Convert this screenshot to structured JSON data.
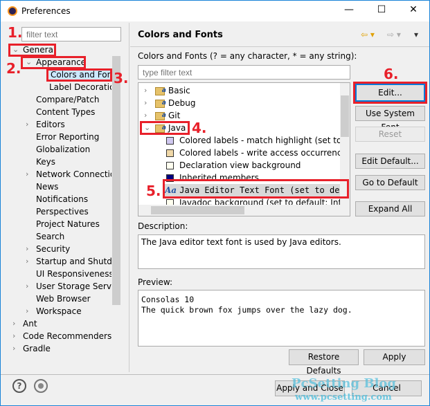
{
  "window": {
    "title": "Preferences",
    "minimize": "—",
    "maximize": "☐",
    "close": "✕"
  },
  "left": {
    "filter_placeholder": "filter text",
    "tree": [
      {
        "label": "General",
        "level": 0,
        "expanded": true
      },
      {
        "label": "Appearance",
        "level": 1,
        "expanded": true
      },
      {
        "label": "Colors and Font",
        "level": 2,
        "selected": true
      },
      {
        "label": "Label Decoratio",
        "level": 2
      },
      {
        "label": "Compare/Patch",
        "level": 1
      },
      {
        "label": "Content Types",
        "level": 1
      },
      {
        "label": "Editors",
        "level": 1,
        "collapsed": true
      },
      {
        "label": "Error Reporting",
        "level": 1
      },
      {
        "label": "Globalization",
        "level": 1
      },
      {
        "label": "Keys",
        "level": 1
      },
      {
        "label": "Network Connectio",
        "level": 1,
        "collapsed": true
      },
      {
        "label": "News",
        "level": 1
      },
      {
        "label": "Notifications",
        "level": 1
      },
      {
        "label": "Perspectives",
        "level": 1
      },
      {
        "label": "Project Natures",
        "level": 1
      },
      {
        "label": "Search",
        "level": 1
      },
      {
        "label": "Security",
        "level": 1,
        "collapsed": true
      },
      {
        "label": "Startup and Shutdo",
        "level": 1,
        "collapsed": true
      },
      {
        "label": "UI Responsiveness",
        "level": 1
      },
      {
        "label": "User Storage Servic",
        "level": 1,
        "collapsed": true
      },
      {
        "label": "Web Browser",
        "level": 1
      },
      {
        "label": "Workspace",
        "level": 1,
        "collapsed": true
      },
      {
        "label": "Ant",
        "level": 0,
        "collapsed": true
      },
      {
        "label": "Code Recommenders",
        "level": 0,
        "collapsed": true
      },
      {
        "label": "Gradle",
        "level": 0,
        "collapsed": true
      }
    ]
  },
  "main": {
    "header": "Colors and Fonts",
    "hint": "Colors and Fonts (? = any character, * = any string):",
    "filter_placeholder": "type filter text",
    "tree": [
      {
        "label": "Basic",
        "type": "folder"
      },
      {
        "label": "Debug",
        "type": "folder"
      },
      {
        "label": "Git",
        "type": "folder"
      },
      {
        "label": "Java",
        "type": "folder",
        "expanded": true
      },
      {
        "label": "Colored labels - match highlight (set to d",
        "type": "color",
        "color": "#d0c8f0"
      },
      {
        "label": "Colored labels - write access occurrences",
        "type": "color",
        "color": "#f0d8a8"
      },
      {
        "label": "Declaration view background",
        "type": "color",
        "color": "#fffff0"
      },
      {
        "label": "Inherited members",
        "type": "color",
        "color": "#000080"
      },
      {
        "label": "Java Editor Text Font (set to de",
        "type": "font",
        "selected": true
      },
      {
        "label": "Javadoc background (set to default: Info",
        "type": "color",
        "color": "#fffff0"
      }
    ],
    "buttons": {
      "edit": "Edit...",
      "use_system_font": "Use System Font",
      "reset": "Reset",
      "edit_default": "Edit Default...",
      "go_to_default": "Go to Default",
      "expand_all": "Expand All"
    },
    "description_label": "Description:",
    "description": "The Java editor text font is used by Java editors.",
    "preview_label": "Preview:",
    "preview_line1": "Consolas 10",
    "preview_line2": "The quick brown fox jumps over the lazy dog.",
    "restore_defaults": "Restore Defaults",
    "apply": "Apply"
  },
  "footer": {
    "apply_close": "Apply and Close",
    "cancel": "Cancel",
    "watermark1": "PcSetting Blog",
    "watermark2": "www.pcsetting.com"
  },
  "annotations": [
    "1.",
    "2.",
    "3.",
    "4.",
    "5.",
    "6."
  ],
  "annotation_color": "#e8202a"
}
